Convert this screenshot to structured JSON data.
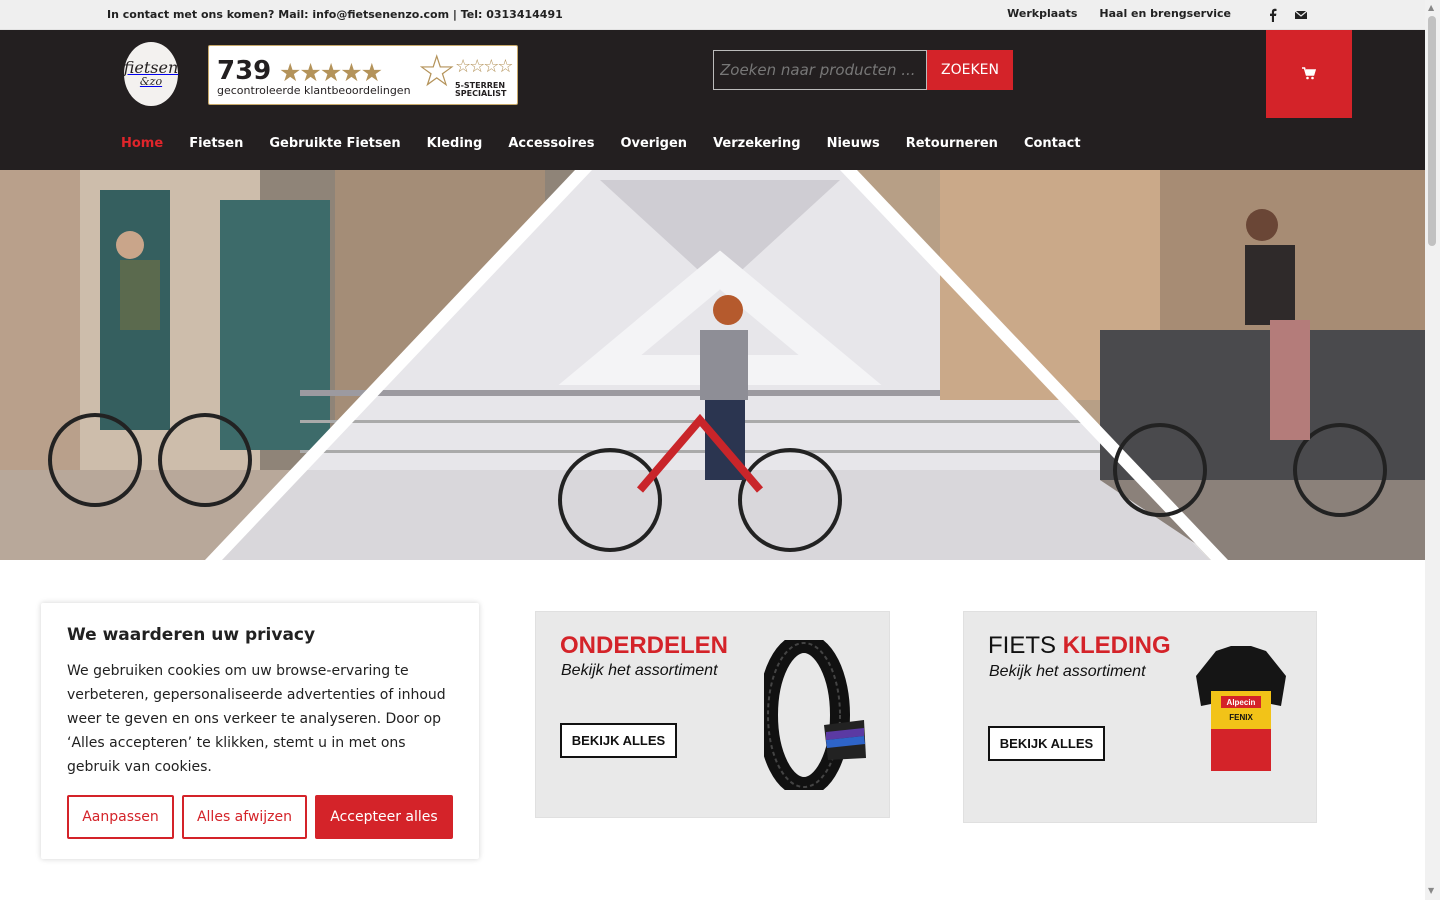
{
  "topbar": {
    "contact_text": "In contact met ons komen? Mail: info@fietsenenzo.com | Tel: 0313414491",
    "links": [
      "Werkplaats",
      "Haal en brengservice"
    ],
    "social_icons": [
      "facebook-icon",
      "mail-icon"
    ]
  },
  "logo": {
    "line1": "fietsen",
    "line2": "&zo"
  },
  "review": {
    "count": "739",
    "stars": "★★★★★",
    "label": "gecontroleerde klantbeoordelingen",
    "badge_line1": "5-STERREN",
    "badge_line2": "SPECIALIST"
  },
  "search": {
    "placeholder": "Zoeken naar producten ...",
    "button_label": "ZOEKEN"
  },
  "cart": {
    "icon": "cart-icon"
  },
  "nav": {
    "items": [
      "Home",
      "Fietsen",
      "Gebruikte Fietsen",
      "Kleding",
      "Accessoires",
      "Overigen",
      "Verzekering",
      "Nieuws",
      "Retourneren",
      "Contact"
    ],
    "active": "Home"
  },
  "cookie": {
    "title": "We waarderen uw privacy",
    "text": "We gebruiken cookies om uw browse-ervaring te verbeteren, gepersonaliseerde advertenties of inhoud weer te geven en ons verkeer te analyseren. Door op ‘Alles accepteren’ te klikken, stemt u in met ons gebruik van cookies.",
    "btn_customize": "Aanpassen",
    "btn_reject": "Alles afwijzen",
    "btn_accept": "Accepteer alles"
  },
  "promos": [
    {
      "title_a": "ONDERDELEN",
      "title_b": "",
      "sub": "Bekijk het assortiment",
      "button": "BEKIJK ALLES"
    },
    {
      "title_a": "FIETS ",
      "title_b": "KLEDING",
      "sub": "Bekijk het assortiment",
      "button": "BEKIJK ALLES",
      "jersey_text_1": "Alpecin",
      "jersey_text_2": "FENIX"
    }
  ],
  "colors": {
    "brand_red": "#d42329",
    "header_dark": "#231f20",
    "gold": "#b4935a"
  }
}
